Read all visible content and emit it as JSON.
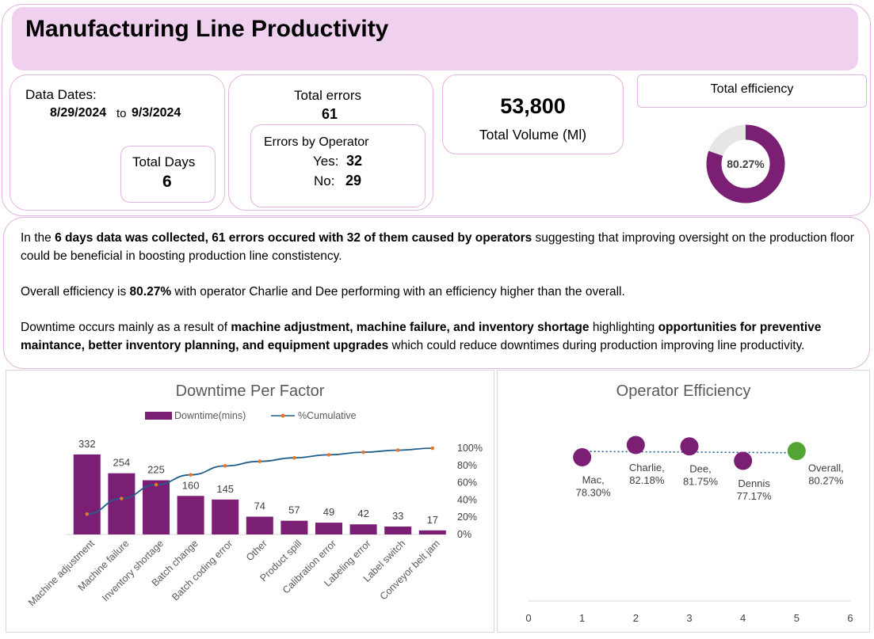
{
  "header": {
    "title": "Manufacturing Line Productivity"
  },
  "dates": {
    "label": "Data Dates:",
    "start": "8/29/2024",
    "to": "to",
    "end": "9/3/2024"
  },
  "days": {
    "label": "Total Days",
    "value": "6"
  },
  "errors": {
    "label": "Total errors",
    "value": "61",
    "by_operator_label": "Errors by Operator",
    "yes_label": "Yes:",
    "yes_value": "32",
    "no_label": "No:",
    "no_value": "29"
  },
  "volume": {
    "value": "53,800",
    "label": "Total Volume (Ml)"
  },
  "efficiency": {
    "label": "Total efficiency",
    "value_text": "80.27%",
    "fraction": 0.8027,
    "fill_color": "#7b1f74",
    "rest_color": "#e6e6e6"
  },
  "insights": {
    "p1_a": "In the ",
    "p1_b": "6 days data was collected, 61 errors occured with 32 of them caused by operators",
    "p1_c": " suggesting that improving oversight  on the production floor could be beneficial in boosting production line constistency.",
    "p2_a": "Overall efficiency is ",
    "p2_b": "80.27%",
    "p2_c": " with operator Charlie and Dee performing with an efficiency higher than the overall.",
    "p3_a": "Downtime occurs mainly as a result of ",
    "p3_b": "machine adjustment, machine failure, and inventory shortage",
    "p3_c": " highlighting ",
    "p3_d": "opportunities for preventive maintance, better inventory planning, and equipment upgrades",
    "p3_e": " which could reduce downtimes during production improving line productivity."
  },
  "chart_data": [
    {
      "type": "bar",
      "title": "Downtime Per Factor",
      "legend": [
        "Downtime(mins)",
        "%Cumulative"
      ],
      "legend_position": "top",
      "categories": [
        "Machine adjustment",
        "Machine failure",
        "Inventory shortage",
        "Batch change",
        "Batch coding error",
        "Other",
        "Product spill",
        "Calibration error",
        "Labeling error",
        "Label switch",
        "Conveyor belt jam"
      ],
      "series": [
        {
          "name": "Downtime(mins)",
          "type": "bar",
          "color": "#7b1f74",
          "values": [
            332,
            254,
            225,
            160,
            145,
            74,
            57,
            49,
            42,
            33,
            17
          ]
        },
        {
          "name": "%Cumulative",
          "type": "line",
          "color": "#1f5f8b",
          "marker_color": "#e8762b",
          "values": [
            23.6,
            41.7,
            57.7,
            69.1,
            79.5,
            84.7,
            88.8,
            92.3,
            95.3,
            97.7,
            100.0
          ]
        }
      ],
      "y_left_range": [
        0,
        450
      ],
      "y_right_ticks": [
        "0%",
        "20%",
        "40%",
        "60%",
        "80%",
        "100%"
      ],
      "y_right_range": [
        0,
        100
      ],
      "grid": false
    },
    {
      "type": "scatter",
      "title": "Operator Efficiency",
      "x_range": [
        0,
        6
      ],
      "x_ticks": [
        0,
        1,
        2,
        3,
        4,
        5,
        6
      ],
      "y_range": [
        0.7,
        0.84
      ],
      "grid": false,
      "points": [
        {
          "x": 1,
          "y": 0.783,
          "label_name": "Mac,",
          "label_value": "78.30%",
          "color": "#7b1f74"
        },
        {
          "x": 2,
          "y": 0.8218,
          "label_name": "Charlie,",
          "label_value": "82.18%",
          "color": "#7b1f74"
        },
        {
          "x": 3,
          "y": 0.8175,
          "label_name": "Dee,",
          "label_value": "81.75%",
          "color": "#7b1f74"
        },
        {
          "x": 4,
          "y": 0.7717,
          "label_name": "Dennis",
          "label_value": "77.17%",
          "color": "#7b1f74"
        },
        {
          "x": 5,
          "y": 0.8027,
          "label_name": "Overall,",
          "label_value": "80.27%",
          "color": "#52a535"
        }
      ],
      "trend_color": "#1f5f8b"
    }
  ]
}
